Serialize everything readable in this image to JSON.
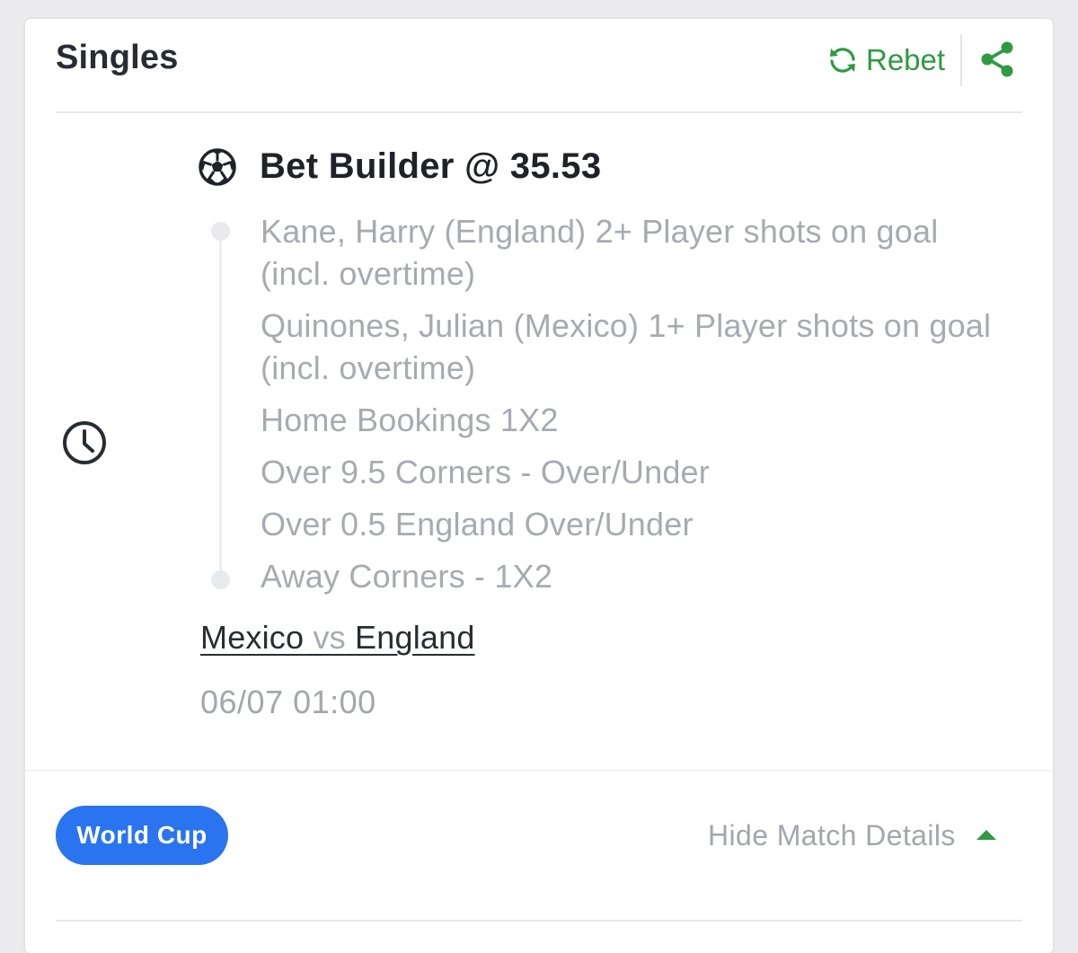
{
  "header": {
    "title": "Singles",
    "rebet_label": "Rebet"
  },
  "bet": {
    "title": "Bet Builder @ 35.53",
    "legs": [
      "Kane, Harry (England) 2+ Player shots on goal (incl. overtime)",
      "Quinones, Julian (Mexico) 1+ Player shots on goal (incl. overtime)",
      "Home Bookings 1X2",
      "Over 9.5 Corners - Over/Under",
      "Over 0.5 England Over/Under",
      "Away Corners - 1X2"
    ],
    "match": {
      "home": "Mexico",
      "separator": "vs",
      "away": "England"
    },
    "datetime": "06/07 01:00"
  },
  "footer": {
    "competition_badge": "World Cup",
    "toggle_label": "Hide Match Details"
  },
  "icons": {
    "rebet": "refresh-icon",
    "share": "share-icon",
    "status": "clock-icon",
    "sport": "soccer-ball-icon",
    "toggle": "caret-up-icon"
  },
  "colors": {
    "accent_green": "#2f9a41",
    "badge_blue": "#2b74f0",
    "muted_text": "#a8aab1",
    "primary_text": "#2a2c33"
  }
}
